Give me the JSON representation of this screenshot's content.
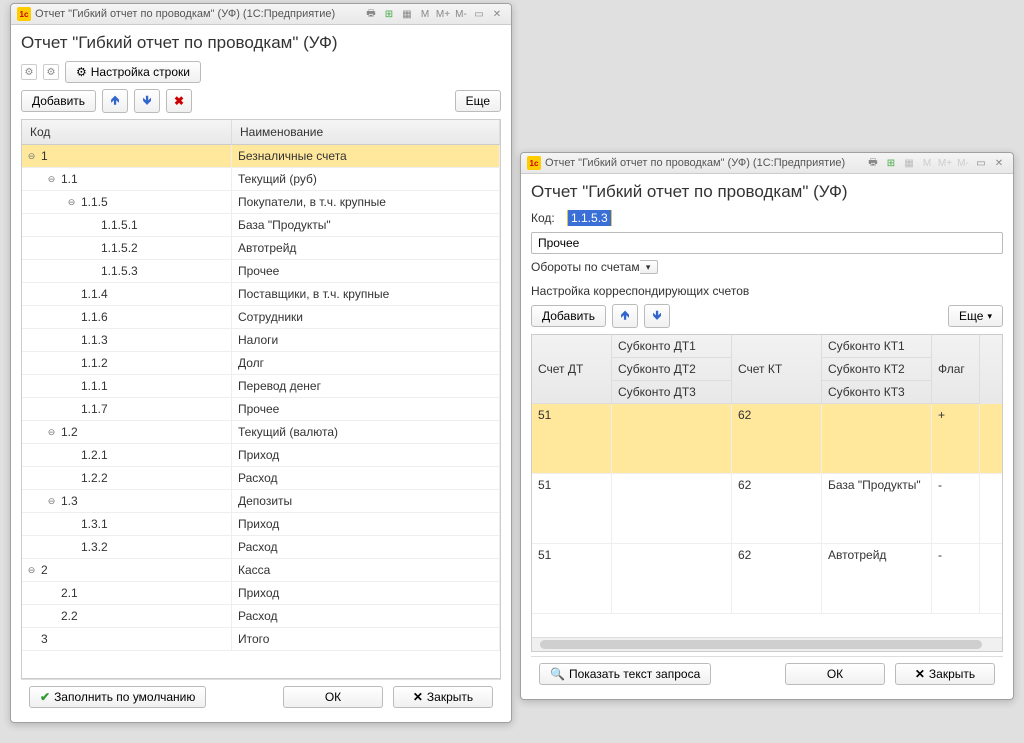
{
  "left": {
    "titlebar": "Отчет \"Гибкий отчет по проводкам\" (УФ)  (1С:Предприятие)",
    "page_title": "Отчет \"Гибкий отчет по проводкам\" (УФ)",
    "tb_settings": "Настройка строки",
    "add_btn": "Добавить",
    "more_btn": "Еще",
    "col_code": "Код",
    "col_name": "Наименование",
    "rows": [
      {
        "code": "1",
        "name": "Безналичные счета",
        "lvl": 0,
        "exp": "⊖",
        "sel": true
      },
      {
        "code": "1.1",
        "name": "Текущий (руб)",
        "lvl": 1,
        "exp": "⊖"
      },
      {
        "code": "1.1.5",
        "name": "Покупатели, в т.ч. крупные",
        "lvl": 2,
        "exp": "⊖"
      },
      {
        "code": "1.1.5.1",
        "name": "База \"Продукты\"",
        "lvl": 3
      },
      {
        "code": "1.1.5.2",
        "name": "Автотрейд",
        "lvl": 3
      },
      {
        "code": "1.1.5.3",
        "name": "Прочее",
        "lvl": 3
      },
      {
        "code": "1.1.4",
        "name": "Поставщики, в т.ч. крупные",
        "lvl": 2
      },
      {
        "code": "1.1.6",
        "name": "Сотрудники",
        "lvl": 2
      },
      {
        "code": "1.1.3",
        "name": "Налоги",
        "lvl": 2
      },
      {
        "code": "1.1.2",
        "name": "Долг",
        "lvl": 2
      },
      {
        "code": "1.1.1",
        "name": "Перевод денег",
        "lvl": 2
      },
      {
        "code": "1.1.7",
        "name": "Прочее",
        "lvl": 2
      },
      {
        "code": "1.2",
        "name": "Текущий (валюта)",
        "lvl": 1,
        "exp": "⊖"
      },
      {
        "code": "1.2.1",
        "name": "Приход",
        "lvl": 2
      },
      {
        "code": "1.2.2",
        "name": "Расход",
        "lvl": 2
      },
      {
        "code": "1.3",
        "name": "Депозиты",
        "lvl": 1,
        "exp": "⊖"
      },
      {
        "code": "1.3.1",
        "name": "Приход",
        "lvl": 2
      },
      {
        "code": "1.3.2",
        "name": "Расход",
        "lvl": 2
      },
      {
        "code": "2",
        "name": "Касса",
        "lvl": 0,
        "exp": "⊖"
      },
      {
        "code": "2.1",
        "name": "Приход",
        "lvl": 1
      },
      {
        "code": "2.2",
        "name": "Расход",
        "lvl": 1
      },
      {
        "code": "3",
        "name": "Итого",
        "lvl": 0
      }
    ],
    "fill_default": "Заполнить по умолчанию",
    "ok": "ОК",
    "close": "Закрыть"
  },
  "right": {
    "titlebar": "Отчет \"Гибкий отчет по проводкам\" (УФ)  (1С:Предприятие)",
    "page_title": "Отчет \"Гибкий отчет по проводкам\" (УФ)",
    "code_label": "Код:",
    "code_value": "1.1.5.3",
    "name_value": "Прочее",
    "combo_value": "Обороты по счетам",
    "section_label": "Настройка корреспондирующих счетов",
    "add_btn": "Добавить",
    "more_btn": "Еще",
    "h_dt": "Счет ДТ",
    "h_sdt1": "Субконто ДТ1",
    "h_sdt2": "Субконто ДТ2",
    "h_sdt3": "Субконто ДТ3",
    "h_kt": "Счет КТ",
    "h_skt1": "Субконто КТ1",
    "h_skt2": "Субконто КТ2",
    "h_skt3": "Субконто КТ3",
    "h_flag": "Флаг",
    "grid_rows": [
      {
        "dt": "51",
        "kt": "62",
        "subk": "",
        "flag": "+",
        "sel": true
      },
      {
        "dt": "51",
        "kt": "62",
        "subk": "База \"Продукты\"",
        "flag": "-"
      },
      {
        "dt": "51",
        "kt": "62",
        "subk": "Автотрейд",
        "flag": "-"
      }
    ],
    "show_query": "Показать текст запроса",
    "ok": "ОК",
    "close": "Закрыть"
  }
}
